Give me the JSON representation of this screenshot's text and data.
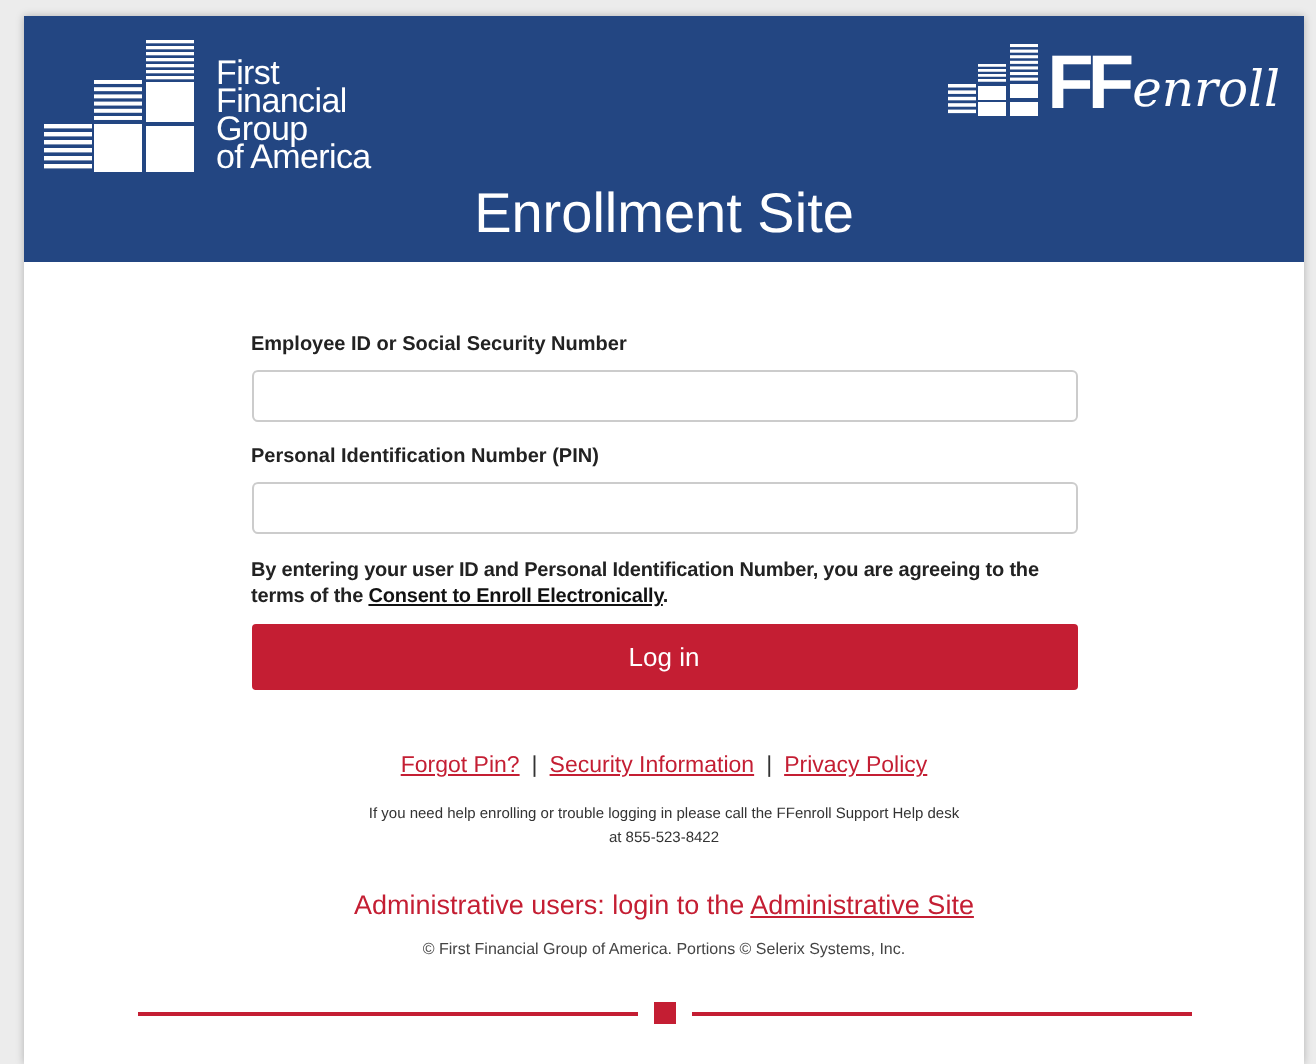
{
  "header": {
    "brand_lines": [
      "First",
      "Financial",
      "Group",
      "of America"
    ],
    "product_logo": {
      "strong": "FF",
      "script": "enroll"
    },
    "title": "Enrollment Site"
  },
  "form": {
    "fields": [
      {
        "label": "Employee ID or Social Security Number"
      },
      {
        "label": "Personal Identification Number (PIN)"
      }
    ],
    "consent": {
      "before": "By entering your user ID and Personal Identification Number, you are agreeing to the terms of the ",
      "link": "Consent to Enroll Electronically",
      "after": "."
    },
    "submit": "Log in"
  },
  "links": [
    "Forgot Pin?",
    "Security Information",
    "Privacy Policy"
  ],
  "link_separator": "|",
  "help": [
    "If you need help enrolling or trouble logging in please call the FFenroll Support Help desk",
    "at 855-523-8422"
  ],
  "admin": {
    "before": "Administrative users: login to the ",
    "link": "Administrative Site"
  },
  "copyright": "© First Financial Group of America. Portions © Selerix Systems, Inc."
}
